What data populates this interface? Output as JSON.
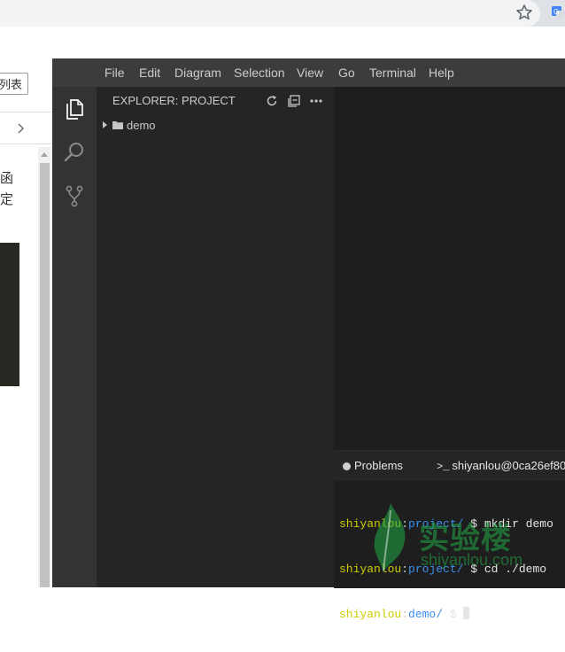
{
  "browser": {
    "star_icon": "star-icon",
    "extension_icon": "translate-icon"
  },
  "doc": {
    "list_button": "列表",
    "text_lines": [
      "函",
      "定"
    ],
    "nav_icon": "chevron-right-icon"
  },
  "ide": {
    "menu": [
      "File",
      "Edit",
      "Diagram",
      "Selection",
      "View",
      "Go",
      "Terminal",
      "Help"
    ],
    "activity_icons": [
      "files-icon",
      "search-icon",
      "source-control-icon"
    ],
    "explorer": {
      "title": "EXPLORER: PROJECT",
      "actions": [
        "refresh-icon",
        "collapse-all-icon",
        "more-icon"
      ],
      "tree": [
        {
          "label": "demo",
          "type": "folder",
          "expanded": false
        }
      ]
    },
    "panel": {
      "tabs": [
        "Problems",
        "shiyanlou@0ca26ef80"
      ],
      "terminal_lines": [
        {
          "user": "shiyanlou",
          "path": "project/",
          "prompt": " $ ",
          "command": "mkdir demo"
        },
        {
          "user": "shiyanlou",
          "path": "project/",
          "prompt": " $ ",
          "command": "cd ./demo"
        },
        {
          "user": "shiyanlou",
          "path": "demo/",
          "prompt": " $ ",
          "command": ""
        }
      ]
    }
  },
  "watermark": {
    "cn": "实验楼",
    "en": "shiyanlou.com"
  },
  "colors": {
    "menubar": "#3c3c3c",
    "activity_bar": "#333333",
    "sidebar": "#252526",
    "editor": "#1e1e1e",
    "terminal_user": "#cdcd00",
    "terminal_path": "#3b8eea",
    "watermark_green": "#22aa46"
  }
}
